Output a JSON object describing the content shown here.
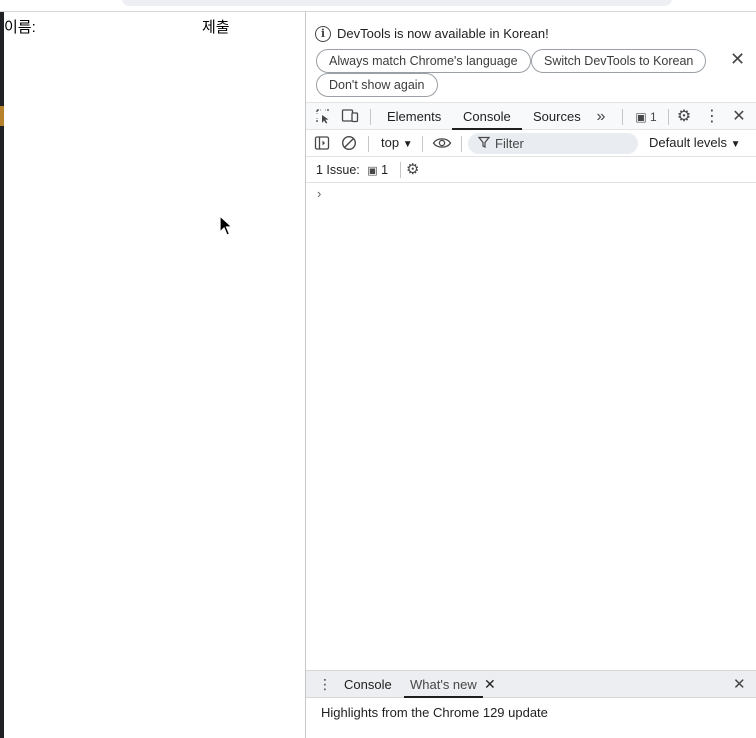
{
  "page": {
    "name_label": "이름:",
    "submit_label": "제출"
  },
  "devtools": {
    "infobar": {
      "message": "DevTools is now available in Korean!",
      "button_match_language": "Always match Chrome's language",
      "button_switch_korean": "Switch DevTools to Korean",
      "button_dont_show": "Don't show again",
      "close_symbol": "✕"
    },
    "tabs": {
      "elements": "Elements",
      "console": "Console",
      "sources": "Sources",
      "more_symbol": "»",
      "issues_count": "1"
    },
    "console_toolbar": {
      "context": "top",
      "filter_placeholder": "Filter",
      "levels": "Default levels"
    },
    "issues": {
      "label": "1 Issue:",
      "count": "1"
    },
    "prompt_symbol": "›",
    "drawer": {
      "tab_console": "Console",
      "tab_whats_new": "What's new",
      "content": "Highlights from the Chrome 129 update"
    }
  },
  "icons": {
    "inspect": "inspect-element-icon",
    "device": "device-toolbar-icon",
    "settings": "gear-icon",
    "kebab": "more-vert-icon",
    "close": "close-icon",
    "sidebar": "sidebar-toggle-icon",
    "clear": "clear-console-icon",
    "eye": "live-expression-icon",
    "filter": "filter-icon",
    "message": "message-icon"
  },
  "colors": {
    "accent_orange": "#b7812b",
    "toolbar_bg": "#f8f9fb",
    "drawer_bg": "#eceef1"
  }
}
